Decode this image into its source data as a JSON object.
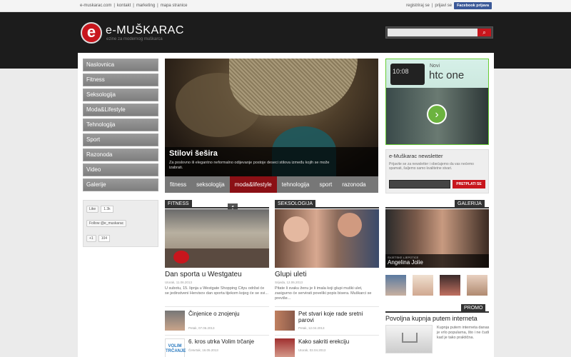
{
  "topbar": {
    "links": [
      "e-muskarac.com",
      "|",
      "kontakt",
      "|",
      "marketing",
      "|",
      "mapa stranice"
    ],
    "register": "registriraj se",
    "sep": "|",
    "login": "prijavi se",
    "fb": "Facebook prijava"
  },
  "logo": {
    "letter": "e",
    "name": "e-MUŠKARAC",
    "tagline": "ezine za modernog muškarca"
  },
  "search": {
    "placeholder": "",
    "icon": "search-icon"
  },
  "nav": [
    "Naslovnica",
    "Fitness",
    "Seksologija",
    "Moda&Lifestyle",
    "Tehnologija",
    "Sport",
    "Razonoda",
    "Video",
    "Galerije"
  ],
  "social": {
    "like": "Like",
    "like_count": "1.3k",
    "follow": "Follow @e_muskarac",
    "gplus": "+1",
    "gplus_count": "104",
    "fb_letter": "f",
    "tw_letter": "t",
    "plus_letter": "+1"
  },
  "slider": {
    "title": "Stilovi šešira",
    "desc": "Za poslovno ili elegantno neformalno odijevanje postoje deseci stilova između kojih se može izabrati.",
    "tabs": [
      "fitness",
      "seksologija",
      "moda&lifestyle",
      "tehnologija",
      "sport",
      "razonoda"
    ],
    "active_tab": "moda&lifestyle"
  },
  "ad": {
    "phone": "10:08",
    "novi": "Novi",
    "brand": "htc one"
  },
  "newsletter": {
    "title": "e-Muškarac newsletter",
    "text": "Prijavite se za newsletter i obećajemo da vas nećemo spamati, šaljemo samo kvalitetne stvari.",
    "button": "PRETPLATI SE"
  },
  "fitness": {
    "label": "FITNESS",
    "title": "Dan sporta u Westgateu",
    "date": "Utorak, 11.06.2013",
    "text": "U subotu, 15. lipnja u Westgate Shopping Cityu održat će se jedinstveni Hervisov dan sporta tijekom kojeg će se svi...",
    "items": [
      {
        "title": "Činjenice o znojenju",
        "date": "Petak, 07.06.2013"
      },
      {
        "title": "6. kros utrka Volim trčanje",
        "date": "Četvrtak, 16.05.2013"
      }
    ]
  },
  "seksologija": {
    "label": "SEKSOLOGIJA",
    "title": "Glupi uleti",
    "date": "Srijeda, 12.06.2013",
    "text": "Pitate li svaku ženu je li imala koji glupi muški ulet, zasigurno će servirati poveliki popis bisera. Muškarci se previše...",
    "items": [
      {
        "title": "Pet stvari koje rade sretni parovi",
        "date": "Petak, 12.04.2013"
      },
      {
        "title": "Kako sakriti erekciju",
        "date": "Utorak, 02.04.2013"
      }
    ]
  },
  "galerija": {
    "label": "GALERIJA",
    "kicker": "SVJETSKE LJEPOTICE",
    "name": "Angelina Jolie"
  },
  "promo": {
    "label": "PROMO",
    "title": "Povoljna kupnja putem interneta",
    "text": "Kupnja putem interneta danas je vrlo popularna, što i ne čudi kad je tako praktična."
  },
  "colors": {
    "accent": "#c8161d",
    "header": "#1c1c1c",
    "nav": "#8b8b8b"
  }
}
